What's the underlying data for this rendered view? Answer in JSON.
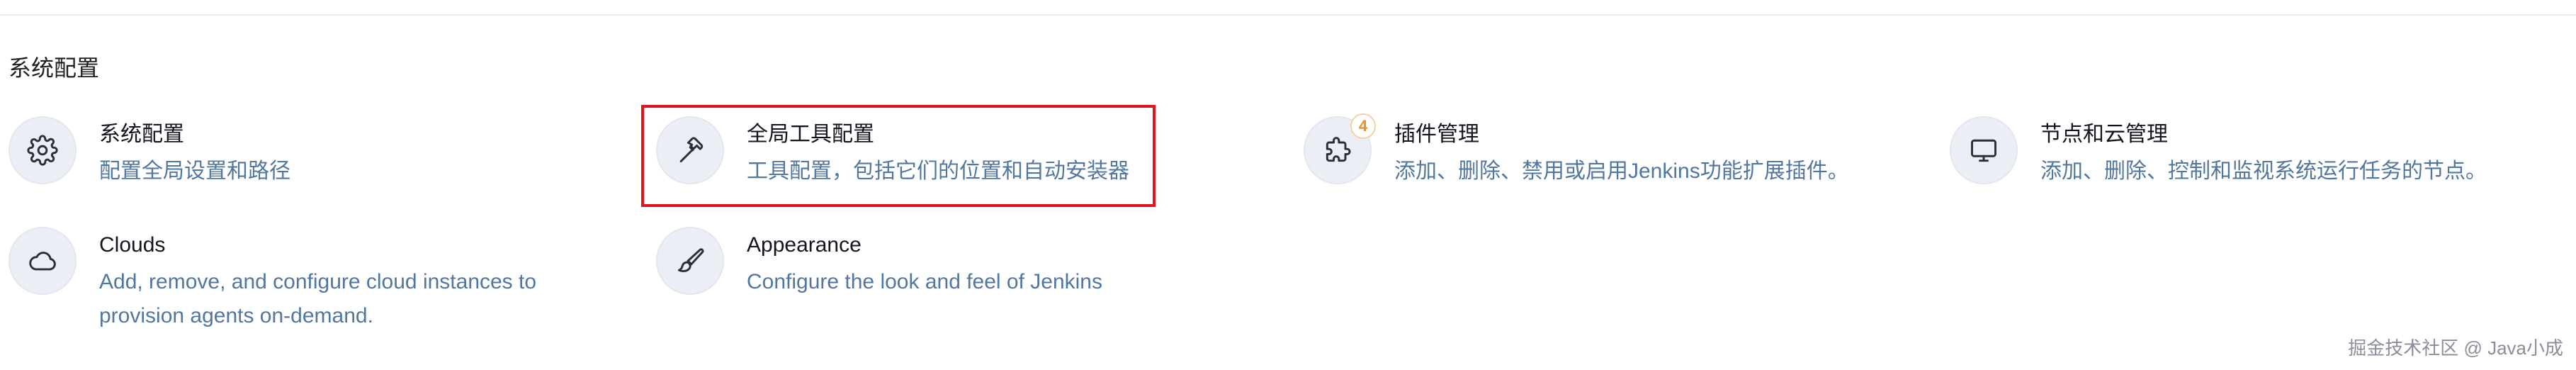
{
  "section": {
    "title": "系统配置"
  },
  "tiles": [
    {
      "name": "系统配置",
      "desc_lines": [
        "配置全局设置和路径"
      ],
      "icon": "gear-icon"
    },
    {
      "name": "全局工具配置",
      "desc_lines": [
        "工具配置，包括它们的位置和自动安装器"
      ],
      "icon": "hammer-icon"
    },
    {
      "name": "插件管理",
      "desc_lines": [
        "添加、删除、禁用或启用Jenkins功能扩展插件。"
      ],
      "icon": "puzzle-icon",
      "badge": "4"
    },
    {
      "name": "节点和云管理",
      "desc_lines": [
        "添加、删除、控制和监视系统运行任务的节点。"
      ],
      "icon": "monitor-icon"
    },
    {
      "name": "Clouds",
      "desc_lines": [
        "Add, remove, and configure cloud instances to",
        "provision agents on-demand."
      ],
      "icon": "cloud-icon"
    },
    {
      "name": "Appearance",
      "desc_lines": [
        "Configure the look and feel of Jenkins"
      ],
      "icon": "brush-icon"
    }
  ],
  "watermark": "掘金技术社区 @ Java小成",
  "colors": {
    "link_blue": "#52779f",
    "highlight_red": "#e2121d",
    "badge_orange": "#ef8d1f",
    "icon_bg": "#eceef5"
  }
}
